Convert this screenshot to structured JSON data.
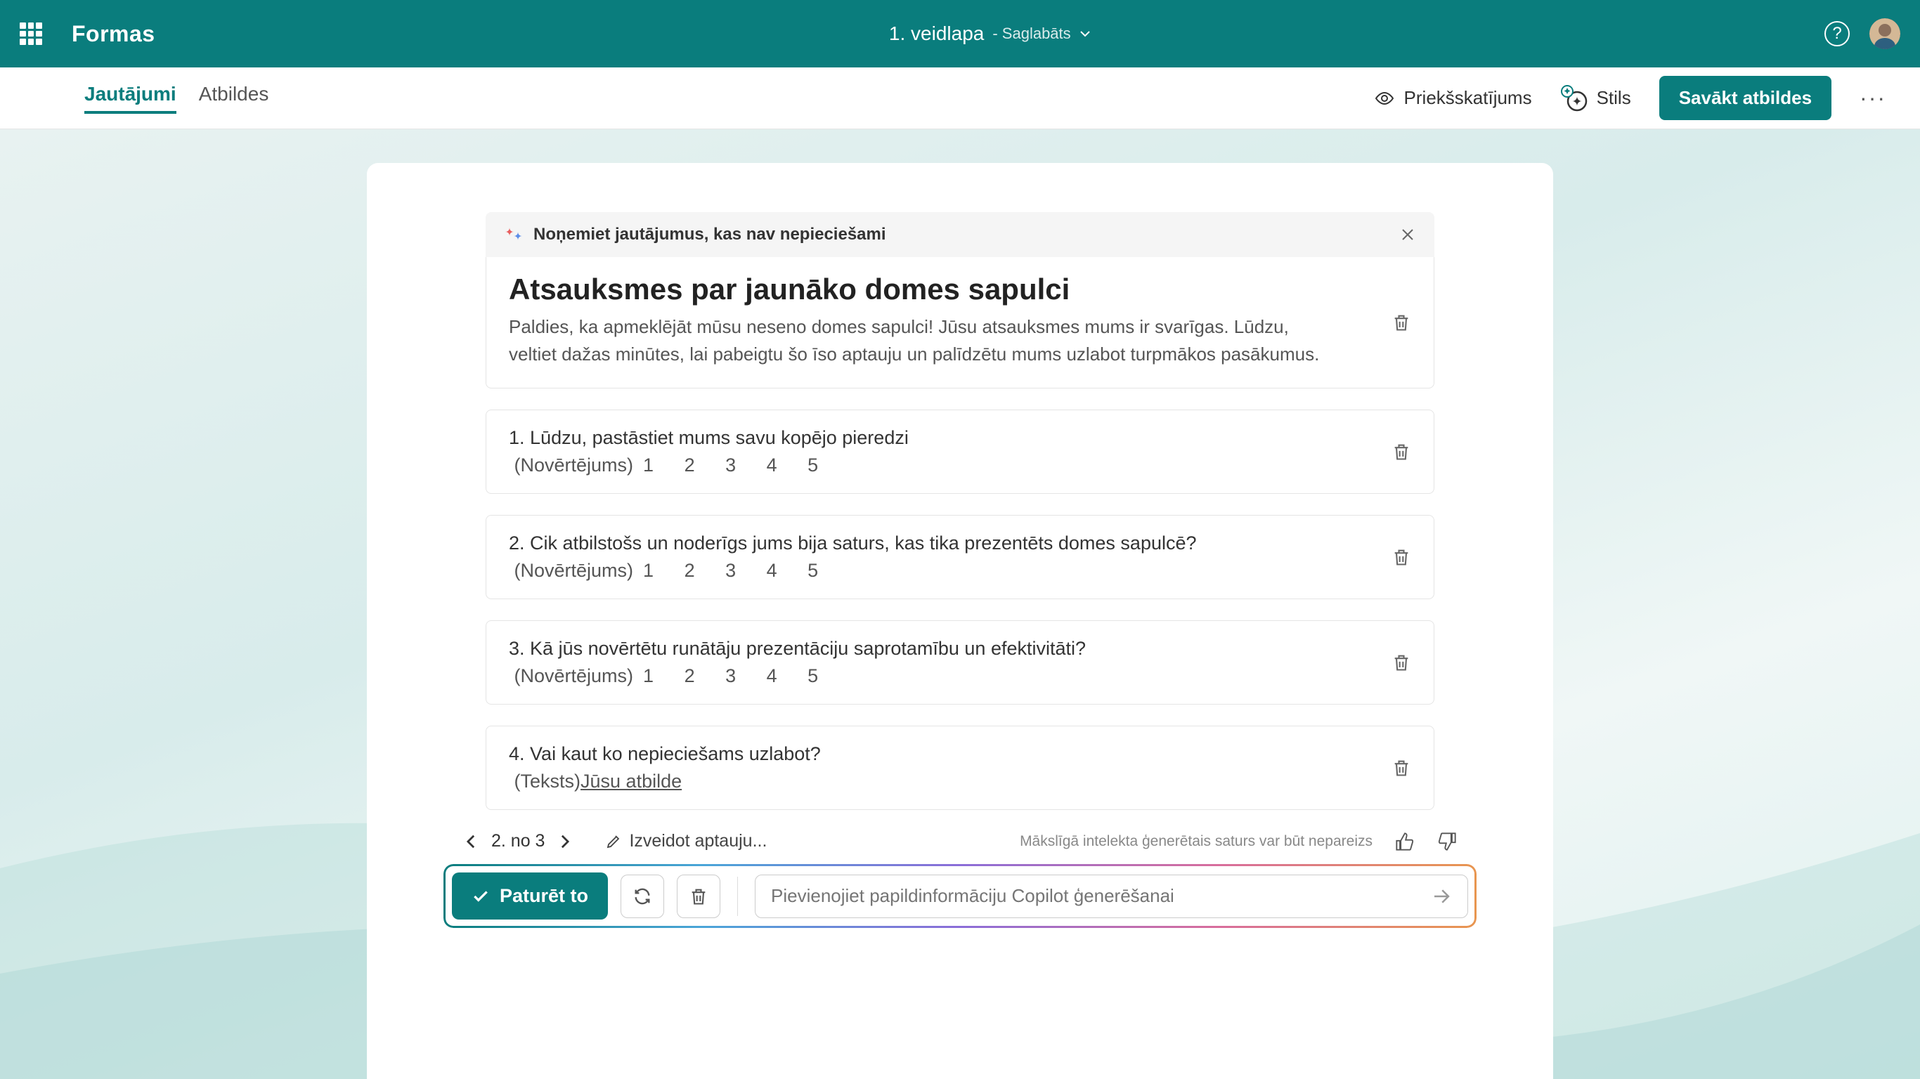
{
  "header": {
    "app_name": "Formas",
    "form_title": "1. veidlapa",
    "saved_label": "- Saglabāts"
  },
  "toolbar": {
    "tabs": {
      "questions": "Jautājumi",
      "responses": "Atbildes"
    },
    "preview": "Priekšskatījums",
    "style": "Stils",
    "collect": "Savākt atbildes"
  },
  "ai_bar": {
    "message": "Noņemiet jautājumus, kas nav nepieciešami"
  },
  "form": {
    "heading": "Atsauksmes par jaunāko domes sapulci",
    "description": "Paldies, ka apmeklējāt mūsu neseno domes sapulci! Jūsu atsauksmes mums ir svarīgas. Lūdzu, veltiet dažas minūtes, lai pabeigtu šo īso aptauju un palīdzētu mums uzlabot turpmākos pasākumus."
  },
  "questions": [
    {
      "num": "1.",
      "text": "Lūdzu, pastāstiet mums savu kopējo pieredzi",
      "type": "(Novērtējums)",
      "scale": "1   2   3   4   5"
    },
    {
      "num": "2.",
      "text": "Cik atbilstošs un noderīgs jums bija saturs, kas tika prezentēts domes sapulcē?",
      "type": "(Novērtējums)",
      "scale": "1   2   3   4   5"
    },
    {
      "num": "3.",
      "text": "Kā jūs novērtētu runātāju prezentāciju saprotamību un efektivitāti?",
      "type": "(Novērtējums)",
      "scale": "1   2   3   4   5"
    },
    {
      "num": "4.",
      "text": "Vai kaut ko nepieciešams uzlabot?",
      "type": "(Teksts)",
      "answer_label": "Jūsu atbilde"
    }
  ],
  "pager": {
    "position": "2. no 3",
    "edit_survey": "Izveidot aptauju..."
  },
  "disclaimer": "Mākslīgā intelekta ģenerētais saturs var būt nepareizs",
  "actions": {
    "keep": "Paturēt to",
    "copilot_placeholder": "Pievienojiet papildinformāciju Copilot ģenerēšanai"
  }
}
